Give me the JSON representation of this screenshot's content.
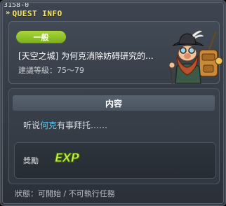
{
  "quest_id": "3158-0",
  "window": {
    "title": "QUEST INFO"
  },
  "quest": {
    "badge": "一般",
    "title": "[天空之城] 为何克消除妨碍研究的...",
    "level_label": "建議等級：",
    "level_range": "75～79"
  },
  "content": {
    "header": "内容",
    "desc_prefix": "听说",
    "desc_npc": "何克",
    "desc_suffix": "有事拜托……"
  },
  "reward": {
    "label": "獎勵",
    "item": "EXP"
  },
  "status": "狀態：可開始 / 不可執行任務",
  "colors": {
    "badge_green": "#8fc22b",
    "title_yellow": "#f4e66a",
    "npc_name_blue": "#58c9f2",
    "exp_green": "#c7f046"
  },
  "icons": {
    "npc": "npc-explorer-portrait-icon",
    "exp": "exp-icon"
  }
}
